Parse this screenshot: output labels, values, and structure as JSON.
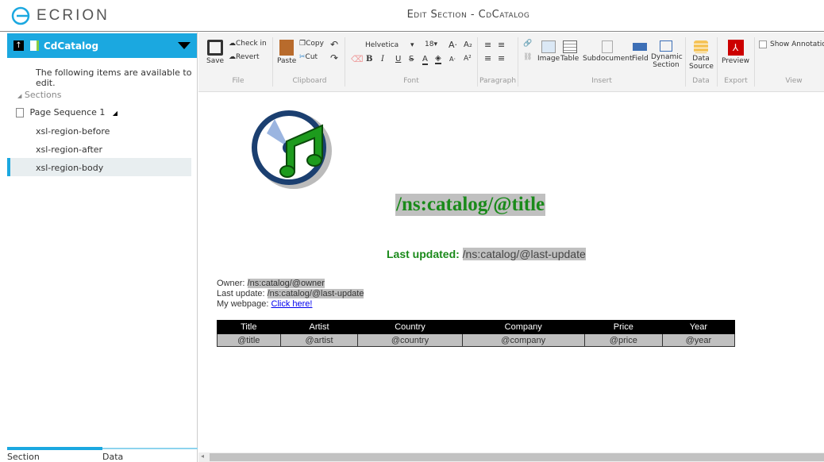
{
  "app": {
    "logo": "ECRION",
    "title": "Edit Section - CdCatalog"
  },
  "sidebar": {
    "doc_name": "CdCatalog",
    "info": "The following items are available to edit.",
    "sections_label": "Sections",
    "page_sequence": "Page Sequence 1",
    "items": [
      {
        "label": "xsl-region-before"
      },
      {
        "label": "xsl-region-after"
      },
      {
        "label": "xsl-region-body",
        "selected": true
      }
    ],
    "tabs": [
      {
        "label": "Section",
        "active": true
      },
      {
        "label": "Data"
      }
    ]
  },
  "ribbon": {
    "file": {
      "label": "File",
      "save": "Save",
      "checkin": "Check in",
      "revert": "Revert"
    },
    "clipboard": {
      "label": "Clipboard",
      "paste": "Paste",
      "copy": "Copy",
      "cut": "Cut"
    },
    "font": {
      "label": "Font",
      "family": "Helvetica",
      "size": "18"
    },
    "paragraph": {
      "label": "Paragraph"
    },
    "insert": {
      "label": "Insert",
      "image": "Image",
      "table": "Table",
      "subdocument": "Subdocument",
      "field": "Field",
      "dynamic": "Dynamic Section"
    },
    "data": {
      "label": "Data",
      "source": "Data Source"
    },
    "export": {
      "label": "Export",
      "preview": "Preview"
    },
    "view": {
      "label": "View",
      "show_annotations": "Show Annotations",
      "checked": false
    }
  },
  "document": {
    "title": "/ns:catalog/@title",
    "last_updated_label": "Last updated:",
    "last_updated_value": "/ns:catalog/@last-update",
    "owner_label": "Owner:",
    "owner_value": "/ns:catalog/@owner",
    "lastupdate_label": "Last update:",
    "lastupdate_value": "/ns:catalog/@last-update",
    "webpage_label": "My webpage:",
    "webpage_link": "Click here!",
    "table": {
      "headers": [
        "Title",
        "Artist",
        "Country",
        "Company",
        "Price",
        "Year"
      ],
      "row": [
        "@title",
        "@artist",
        "@country",
        "@company",
        "@price",
        "@year"
      ]
    }
  },
  "colors": {
    "accent": "#1ba8e0",
    "title_green": "#1a8a1a",
    "highlight": "#c0c0c0"
  }
}
